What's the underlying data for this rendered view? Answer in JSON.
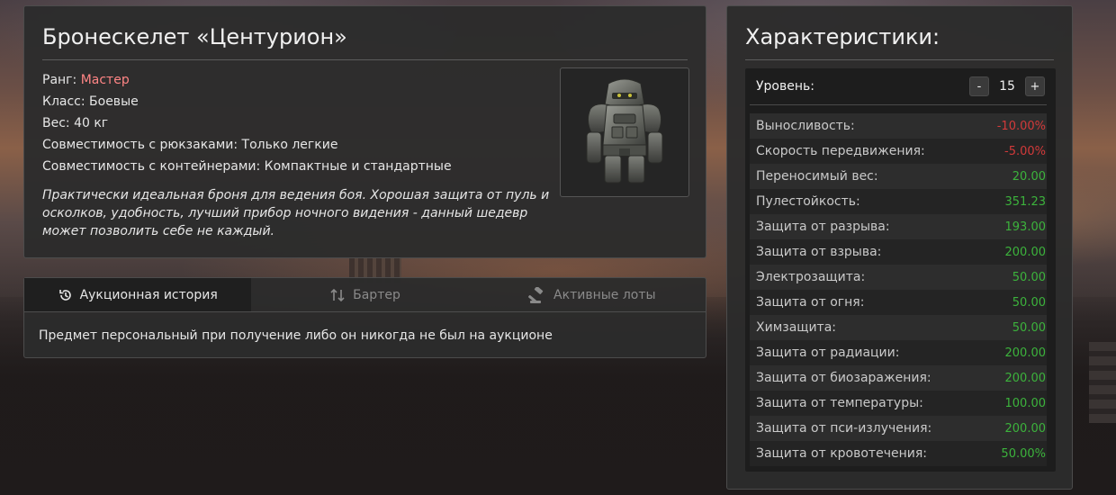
{
  "item": {
    "title": "Бронескелет «Центурион»",
    "rank_label": "Ранг: ",
    "rank_value": "Мастер",
    "class_text": "Класс: Боевые",
    "weight_text": "Вес: 40 кг",
    "backpack_text": "Совместимость с рюкзаками: Только легкие",
    "container_text": "Совместимость с контейнерами: Компактные и стандартные",
    "description": "Практически идеальная броня для ведения боя. Хорошая защита от пуль и осколков, удобность, лучший прибор ночного видения - данный шедевр может позволить себе не каждый.",
    "image_icon": "armor-exoskeleton-icon"
  },
  "auction": {
    "tabs": [
      {
        "label": "Аукционная история",
        "icon": "history-icon",
        "active": true
      },
      {
        "label": "Бартер",
        "icon": "swap-arrows-icon",
        "active": false
      },
      {
        "label": "Активные лоты",
        "icon": "gavel-icon",
        "active": false
      }
    ],
    "message": "Предмет персональный при получение либо он никогда не был на аукционе"
  },
  "stats": {
    "title": "Характеристики:",
    "level_label": "Уровень:",
    "level_value": "15",
    "minus_label": "-",
    "plus_label": "+",
    "rows": [
      {
        "name": "Выносливость:",
        "value": "-10.00%",
        "sign": "neg"
      },
      {
        "name": "Скорость передвижения:",
        "value": "-5.00%",
        "sign": "neg"
      },
      {
        "name": "Переносимый вес:",
        "value": "20.00",
        "sign": "pos"
      },
      {
        "name": "Пулестойкость:",
        "value": "351.23",
        "sign": "pos"
      },
      {
        "name": "Защита от разрыва:",
        "value": "193.00",
        "sign": "pos"
      },
      {
        "name": "Защита от взрыва:",
        "value": "200.00",
        "sign": "pos"
      },
      {
        "name": "Электрозащита:",
        "value": "50.00",
        "sign": "pos"
      },
      {
        "name": "Защита от огня:",
        "value": "50.00",
        "sign": "pos"
      },
      {
        "name": "Химзащита:",
        "value": "50.00",
        "sign": "pos"
      },
      {
        "name": "Защита от радиации:",
        "value": "200.00",
        "sign": "pos"
      },
      {
        "name": "Защита от биозаражения:",
        "value": "200.00",
        "sign": "pos"
      },
      {
        "name": "Защита от температуры:",
        "value": "100.00",
        "sign": "pos"
      },
      {
        "name": "Защита от пси-излучения:",
        "value": "200.00",
        "sign": "pos"
      },
      {
        "name": "Защита от кровотечения:",
        "value": "50.00%",
        "sign": "pos"
      }
    ]
  },
  "colors": {
    "rank": "#ff8585",
    "negative": "#d23a3a",
    "positive": "#3cb33c"
  }
}
